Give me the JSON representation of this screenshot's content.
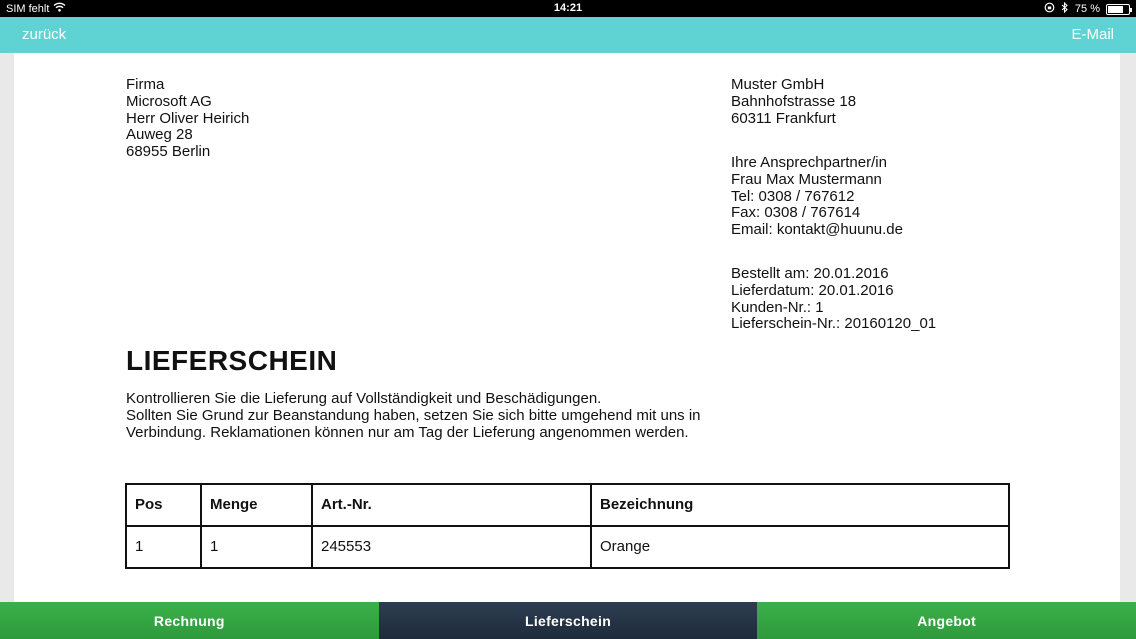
{
  "status_bar": {
    "carrier": "SIM fehlt",
    "time": "14:21",
    "battery": "75 %",
    "battery_level": 0.75,
    "icons": [
      "wifi-icon",
      "lock-rotation-icon",
      "bluetooth-icon",
      "battery-icon"
    ]
  },
  "nav": {
    "back_label": "zurück",
    "email_label": "E-Mail"
  },
  "document": {
    "recipient": [
      "Firma",
      "Microsoft AG",
      "Herr Oliver Heirich",
      "Auweg 28",
      "68955 Berlin"
    ],
    "sender": [
      "Muster GmbH",
      "Bahnhofstrasse 18",
      "60311 Frankfurt"
    ],
    "contact": [
      "Ihre Ansprechpartner/in",
      "Frau Max Mustermann",
      "Tel: 0308 / 767612",
      "Fax: 0308 / 767614",
      "Email: kontakt@huunu.de"
    ],
    "order_info": [
      "Bestellt am: 20.01.2016",
      "Lieferdatum: 20.01.2016",
      "Kunden-Nr.: 1",
      "Lieferschein-Nr.: 20160120_01"
    ],
    "title": "LIEFERSCHEIN",
    "notice": [
      "Kontrollieren Sie die Lieferung auf Vollständigkeit und Beschädigungen.",
      "Sollten Sie Grund zur Beanstandung haben, setzen Sie sich bitte umgehend mit uns in",
      "Verbindung. Reklamationen können nur am Tag der Lieferung angenommen werden."
    ],
    "table": {
      "headers": [
        "Pos",
        "Menge",
        "Art.-Nr.",
        "Bezeichnung"
      ],
      "rows": [
        [
          "1",
          "1",
          "245553",
          "Orange"
        ]
      ]
    }
  },
  "tabs": [
    {
      "label": "Rechnung",
      "active": false
    },
    {
      "label": "Lieferschein",
      "active": true
    },
    {
      "label": "Angebot",
      "active": false
    }
  ],
  "colors": {
    "nav_bar": "#5fd3d3",
    "tab_green": "#34a744",
    "tab_active": "#25354a",
    "status_bar": "#000000"
  }
}
